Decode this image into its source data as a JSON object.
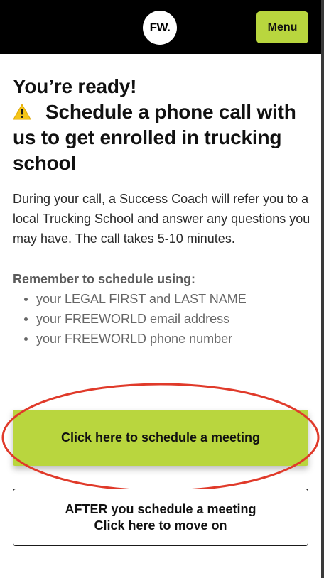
{
  "header": {
    "logo_text": "FW.",
    "menu_label": "Menu"
  },
  "main": {
    "heading_line1": "You’re ready!",
    "heading_rest": "Schedule a phone call with us to get enrolled in trucking school",
    "warning_icon": "warning-icon",
    "intro": "During your call, a Success Coach will refer you to a local Trucking School and answer any questions you may have. The call takes 5-10 minutes.",
    "reminder_title": "Remember to schedule using:",
    "reminders": [
      "your LEGAL FIRST and LAST NAME",
      "your FREEWORLD email address",
      "your FREEWORLD phone number"
    ]
  },
  "actions": {
    "schedule_label": "Click here to schedule a meeting",
    "after_line1": "AFTER you schedule a meeting",
    "after_line2": "Click here to move on"
  },
  "colors": {
    "accent_green": "#b9d63e",
    "header_black": "#000000",
    "annotation_red": "#e03a2a",
    "warning_yellow": "#f5c518"
  }
}
